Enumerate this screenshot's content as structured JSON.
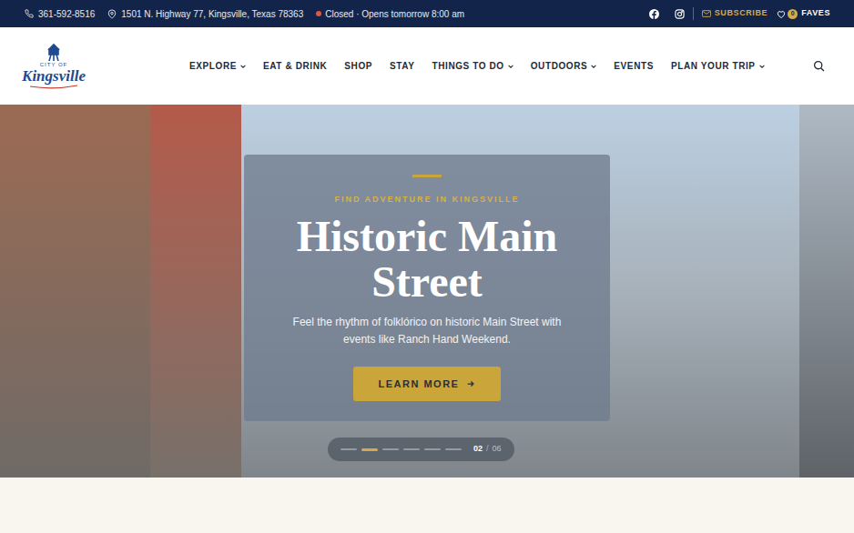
{
  "topbar": {
    "phone": "361-592-8516",
    "address": "1501 N. Highway 77, Kingsville, Texas 78363",
    "status": {
      "open": false,
      "text": "Closed · Opens tomorrow 8:00 am"
    },
    "subscribe": "SUBSCRIBE",
    "faves": {
      "count": "0",
      "label": "FAVES"
    }
  },
  "logo": {
    "small": "CITY OF",
    "name": "Kingsville"
  },
  "nav": [
    {
      "label": "EXPLORE",
      "dropdown": true
    },
    {
      "label": "EAT & DRINK",
      "dropdown": false
    },
    {
      "label": "SHOP",
      "dropdown": false
    },
    {
      "label": "STAY",
      "dropdown": false
    },
    {
      "label": "THINGS TO DO",
      "dropdown": true
    },
    {
      "label": "OUTDOORS",
      "dropdown": true
    },
    {
      "label": "EVENTS",
      "dropdown": false
    },
    {
      "label": "PLAN YOUR TRIP",
      "dropdown": true
    }
  ],
  "hero": {
    "eyebrow": "FIND ADVENTURE IN KINGSVILLE",
    "title": "Historic Main Street",
    "text": "Feel the rhythm of folklórico on historic Main Street with events like Ranch Hand Weekend.",
    "button": "LEARN MORE",
    "slides": [
      {
        "selected": false
      },
      {
        "selected": true
      },
      {
        "selected": false
      },
      {
        "selected": false
      },
      {
        "selected": false
      },
      {
        "selected": false
      }
    ],
    "current": "02",
    "separator": "/",
    "total": "06"
  }
}
